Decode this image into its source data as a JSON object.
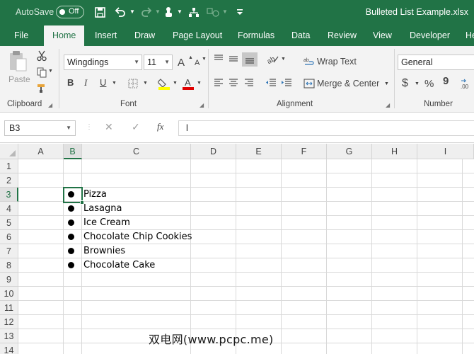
{
  "titlebar": {
    "autosave_label": "AutoSave",
    "autosave_state": "Off",
    "filename": "Bulleted List Example.xlsx",
    "icons": [
      "save-icon",
      "undo-icon",
      "redo-icon",
      "touch-mode-icon",
      "structure-icon",
      "shapes-icon",
      "customize-icon"
    ]
  },
  "tabs": [
    "File",
    "Home",
    "Insert",
    "Draw",
    "Page Layout",
    "Formulas",
    "Data",
    "Review",
    "View",
    "Developer",
    "He"
  ],
  "active_tab": "Home",
  "ribbon": {
    "clipboard": {
      "label": "Clipboard",
      "paste": "Paste"
    },
    "font": {
      "label": "Font",
      "family": "Wingdings",
      "size": "11",
      "bold": "B",
      "italic": "I",
      "underline": "U",
      "grow": "A",
      "shrink": "A"
    },
    "alignment": {
      "label": "Alignment",
      "wrap_text": "Wrap Text",
      "merge_center": "Merge & Center"
    },
    "number": {
      "label": "Number",
      "format": "General",
      "currency": "$",
      "percent": "%",
      "comma": "9"
    }
  },
  "formula_bar": {
    "name_box": "B3",
    "cancel": "✕",
    "enter": "✓",
    "fx": "fx",
    "formula": "l"
  },
  "columns": [
    "A",
    "B",
    "C",
    "D",
    "E",
    "F",
    "G",
    "H",
    "I"
  ],
  "rows": [
    "1",
    "2",
    "3",
    "4",
    "5",
    "6",
    "7",
    "8",
    "9",
    "10",
    "11",
    "12",
    "13",
    "14"
  ],
  "selected_cell": "B3",
  "list_items": [
    "Pizza",
    "Lasagna",
    "Ice Cream",
    "Chocolate Chip Cookies",
    "Brownies",
    "Chocolate Cake"
  ],
  "watermark": "双电网(www.pcpc.me)",
  "colors": {
    "accent": "#217346",
    "grid": "#d9d9d9",
    "header_bg": "#efefef"
  }
}
